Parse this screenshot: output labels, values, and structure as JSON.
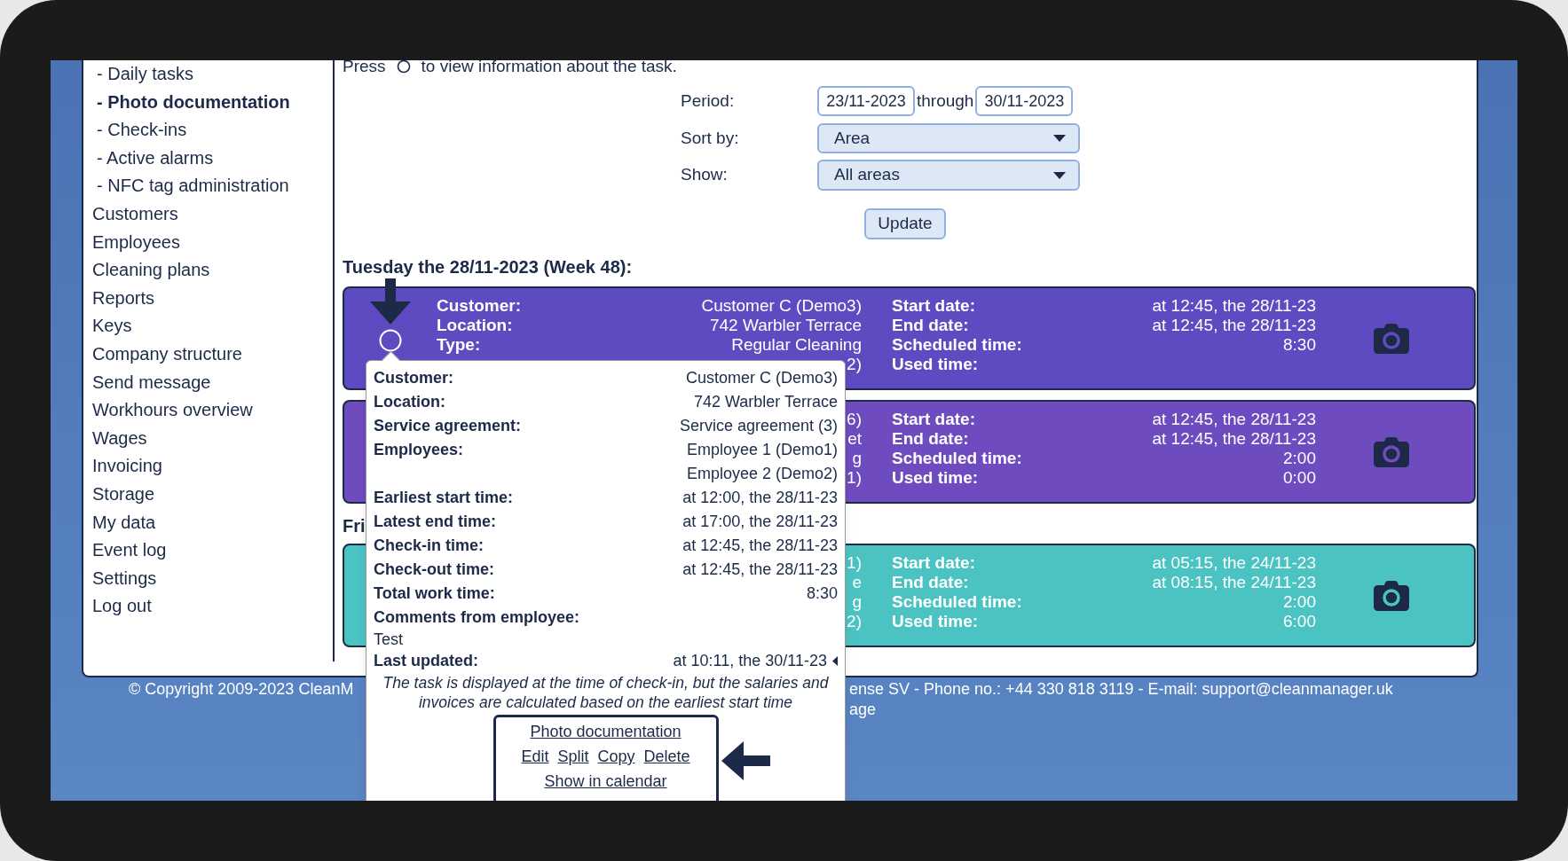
{
  "sidebar": {
    "items": [
      {
        "label": "- Daily tasks",
        "kind": "sub",
        "selected": false
      },
      {
        "label": "- Photo documentation",
        "kind": "sub",
        "selected": true
      },
      {
        "label": "- Check-ins",
        "kind": "sub",
        "selected": false
      },
      {
        "label": "- Active alarms",
        "kind": "sub",
        "selected": false
      },
      {
        "label": "- NFC tag administration",
        "kind": "sub",
        "selected": false
      },
      {
        "label": "Customers",
        "kind": "main",
        "selected": false
      },
      {
        "label": "Employees",
        "kind": "main",
        "selected": false
      },
      {
        "label": "Cleaning plans",
        "kind": "main",
        "selected": false
      },
      {
        "label": "Reports",
        "kind": "main",
        "selected": false
      },
      {
        "label": "Keys",
        "kind": "main",
        "selected": false
      },
      {
        "label": "Company structure",
        "kind": "main",
        "selected": false
      },
      {
        "label": "Send message",
        "kind": "main",
        "selected": false
      },
      {
        "label": "Workhours overview",
        "kind": "main",
        "selected": false
      },
      {
        "label": "Wages",
        "kind": "main",
        "selected": false
      },
      {
        "label": "Invoicing",
        "kind": "main",
        "selected": false
      },
      {
        "label": "Storage",
        "kind": "main",
        "selected": false
      },
      {
        "label": "My data",
        "kind": "main",
        "selected": false
      },
      {
        "label": "Event log",
        "kind": "main",
        "selected": false
      },
      {
        "label": "Settings",
        "kind": "main",
        "selected": false
      },
      {
        "label": "Log out",
        "kind": "main",
        "selected": false
      }
    ]
  },
  "intro": {
    "before": "Press",
    "after": "to view information about the task."
  },
  "filters": {
    "period_label": "Period:",
    "from": "23/11-2023",
    "through_label": "through",
    "to": "30/11-2023",
    "sort_label": "Sort by:",
    "sort_value": "Area",
    "show_label": "Show:",
    "show_value": "All areas",
    "update_button": "Update"
  },
  "days": [
    {
      "heading": "Tuesday the 28/11-2023 (Week 48):",
      "cards": [
        {
          "color": "#5f4bc1",
          "info_icon": true,
          "details": [
            {
              "label": "Customer:",
              "value": "Customer C (Demo3)"
            },
            {
              "label": "Location:",
              "value": "742 Warbler Terrace"
            },
            {
              "label": "Type:",
              "value": "Regular Cleaning"
            },
            {
              "value": "2)"
            }
          ],
          "times": [
            {
              "label": "Start date:",
              "value": "at 12:45, the 28/11-23"
            },
            {
              "label": "End date:",
              "value": "at 12:45, the 28/11-23"
            },
            {
              "label": "Scheduled time:",
              "value": "8:30"
            },
            {
              "label": "Used time:"
            }
          ]
        },
        {
          "color": "#6f4bc0",
          "info_icon": false,
          "details": [
            {
              "value": "6)"
            },
            {
              "value": "et"
            },
            {
              "value": "g"
            },
            {
              "value": "1)"
            }
          ],
          "times": [
            {
              "label": "Start date:",
              "value": "at 12:45, the 28/11-23"
            },
            {
              "label": "End date:",
              "value": "at 12:45, the 28/11-23"
            },
            {
              "label": "Scheduled time:",
              "value": "2:00"
            },
            {
              "label": "Used time:",
              "value": "0:00"
            }
          ]
        }
      ]
    },
    {
      "heading": "Fri",
      "cards": [
        {
          "color": "#4cc3c3",
          "info_icon": false,
          "details": [
            {
              "value": "1)"
            },
            {
              "value": "e"
            },
            {
              "value": "g"
            },
            {
              "value": "2)"
            }
          ],
          "times": [
            {
              "label": "Start date:",
              "value": "at 05:15, the 24/11-23"
            },
            {
              "label": "End date:",
              "value": "at 08:15, the 24/11-23"
            },
            {
              "label": "Scheduled time:",
              "value": "2:00"
            },
            {
              "label": "Used time:",
              "value": "6:00"
            }
          ]
        }
      ]
    }
  ],
  "popup": {
    "rows": [
      {
        "kind": "pair",
        "label": "Customer:",
        "values": [
          "Customer C (Demo3)"
        ]
      },
      {
        "kind": "pair",
        "label": "Location:",
        "values": [
          "742 Warbler Terrace"
        ]
      },
      {
        "kind": "pair",
        "label": "Service agreement:",
        "values": [
          "Service agreement (3)"
        ]
      },
      {
        "kind": "pair",
        "label": "Employees:",
        "values": [
          "Employee 1 (Demo1)",
          "Employee 2 (Demo2)"
        ]
      },
      {
        "kind": "pair",
        "label": "Earliest start time:",
        "values": [
          "at 12:00, the 28/11-23"
        ]
      },
      {
        "kind": "pair",
        "label": "Latest end time:",
        "values": [
          "at 17:00, the 28/11-23"
        ]
      },
      {
        "kind": "pair",
        "label": "Check-in time:",
        "values": [
          "at 12:45, the 28/11-23"
        ]
      },
      {
        "kind": "pair",
        "label": "Check-out time:",
        "values": [
          "at 12:45, the 28/11-23"
        ]
      },
      {
        "kind": "pair",
        "label": "Total work time:",
        "values": [
          "8:30"
        ]
      },
      {
        "kind": "comment",
        "label": "Comments from employee:",
        "text": "Test"
      },
      {
        "kind": "pair",
        "label": "Last updated:",
        "values": [
          "at 10:11, the 30/11-23"
        ],
        "marker": true
      }
    ],
    "note": "The task is displayed at the time of check-in, but the salaries and invoices are calculated based on the earliest start time",
    "links": [
      [
        "Photo documentation"
      ],
      [
        "Edit",
        "Split",
        "Copy",
        "Delete"
      ],
      [
        "Show in calendar"
      ]
    ]
  },
  "footer": {
    "left": "© Copyright 2009-2023 CleanM",
    "right": "ense SV - Phone no.: +44 330 818 3119 - E-mail: support@cleanmanager.uk",
    "right_line2": "age"
  }
}
